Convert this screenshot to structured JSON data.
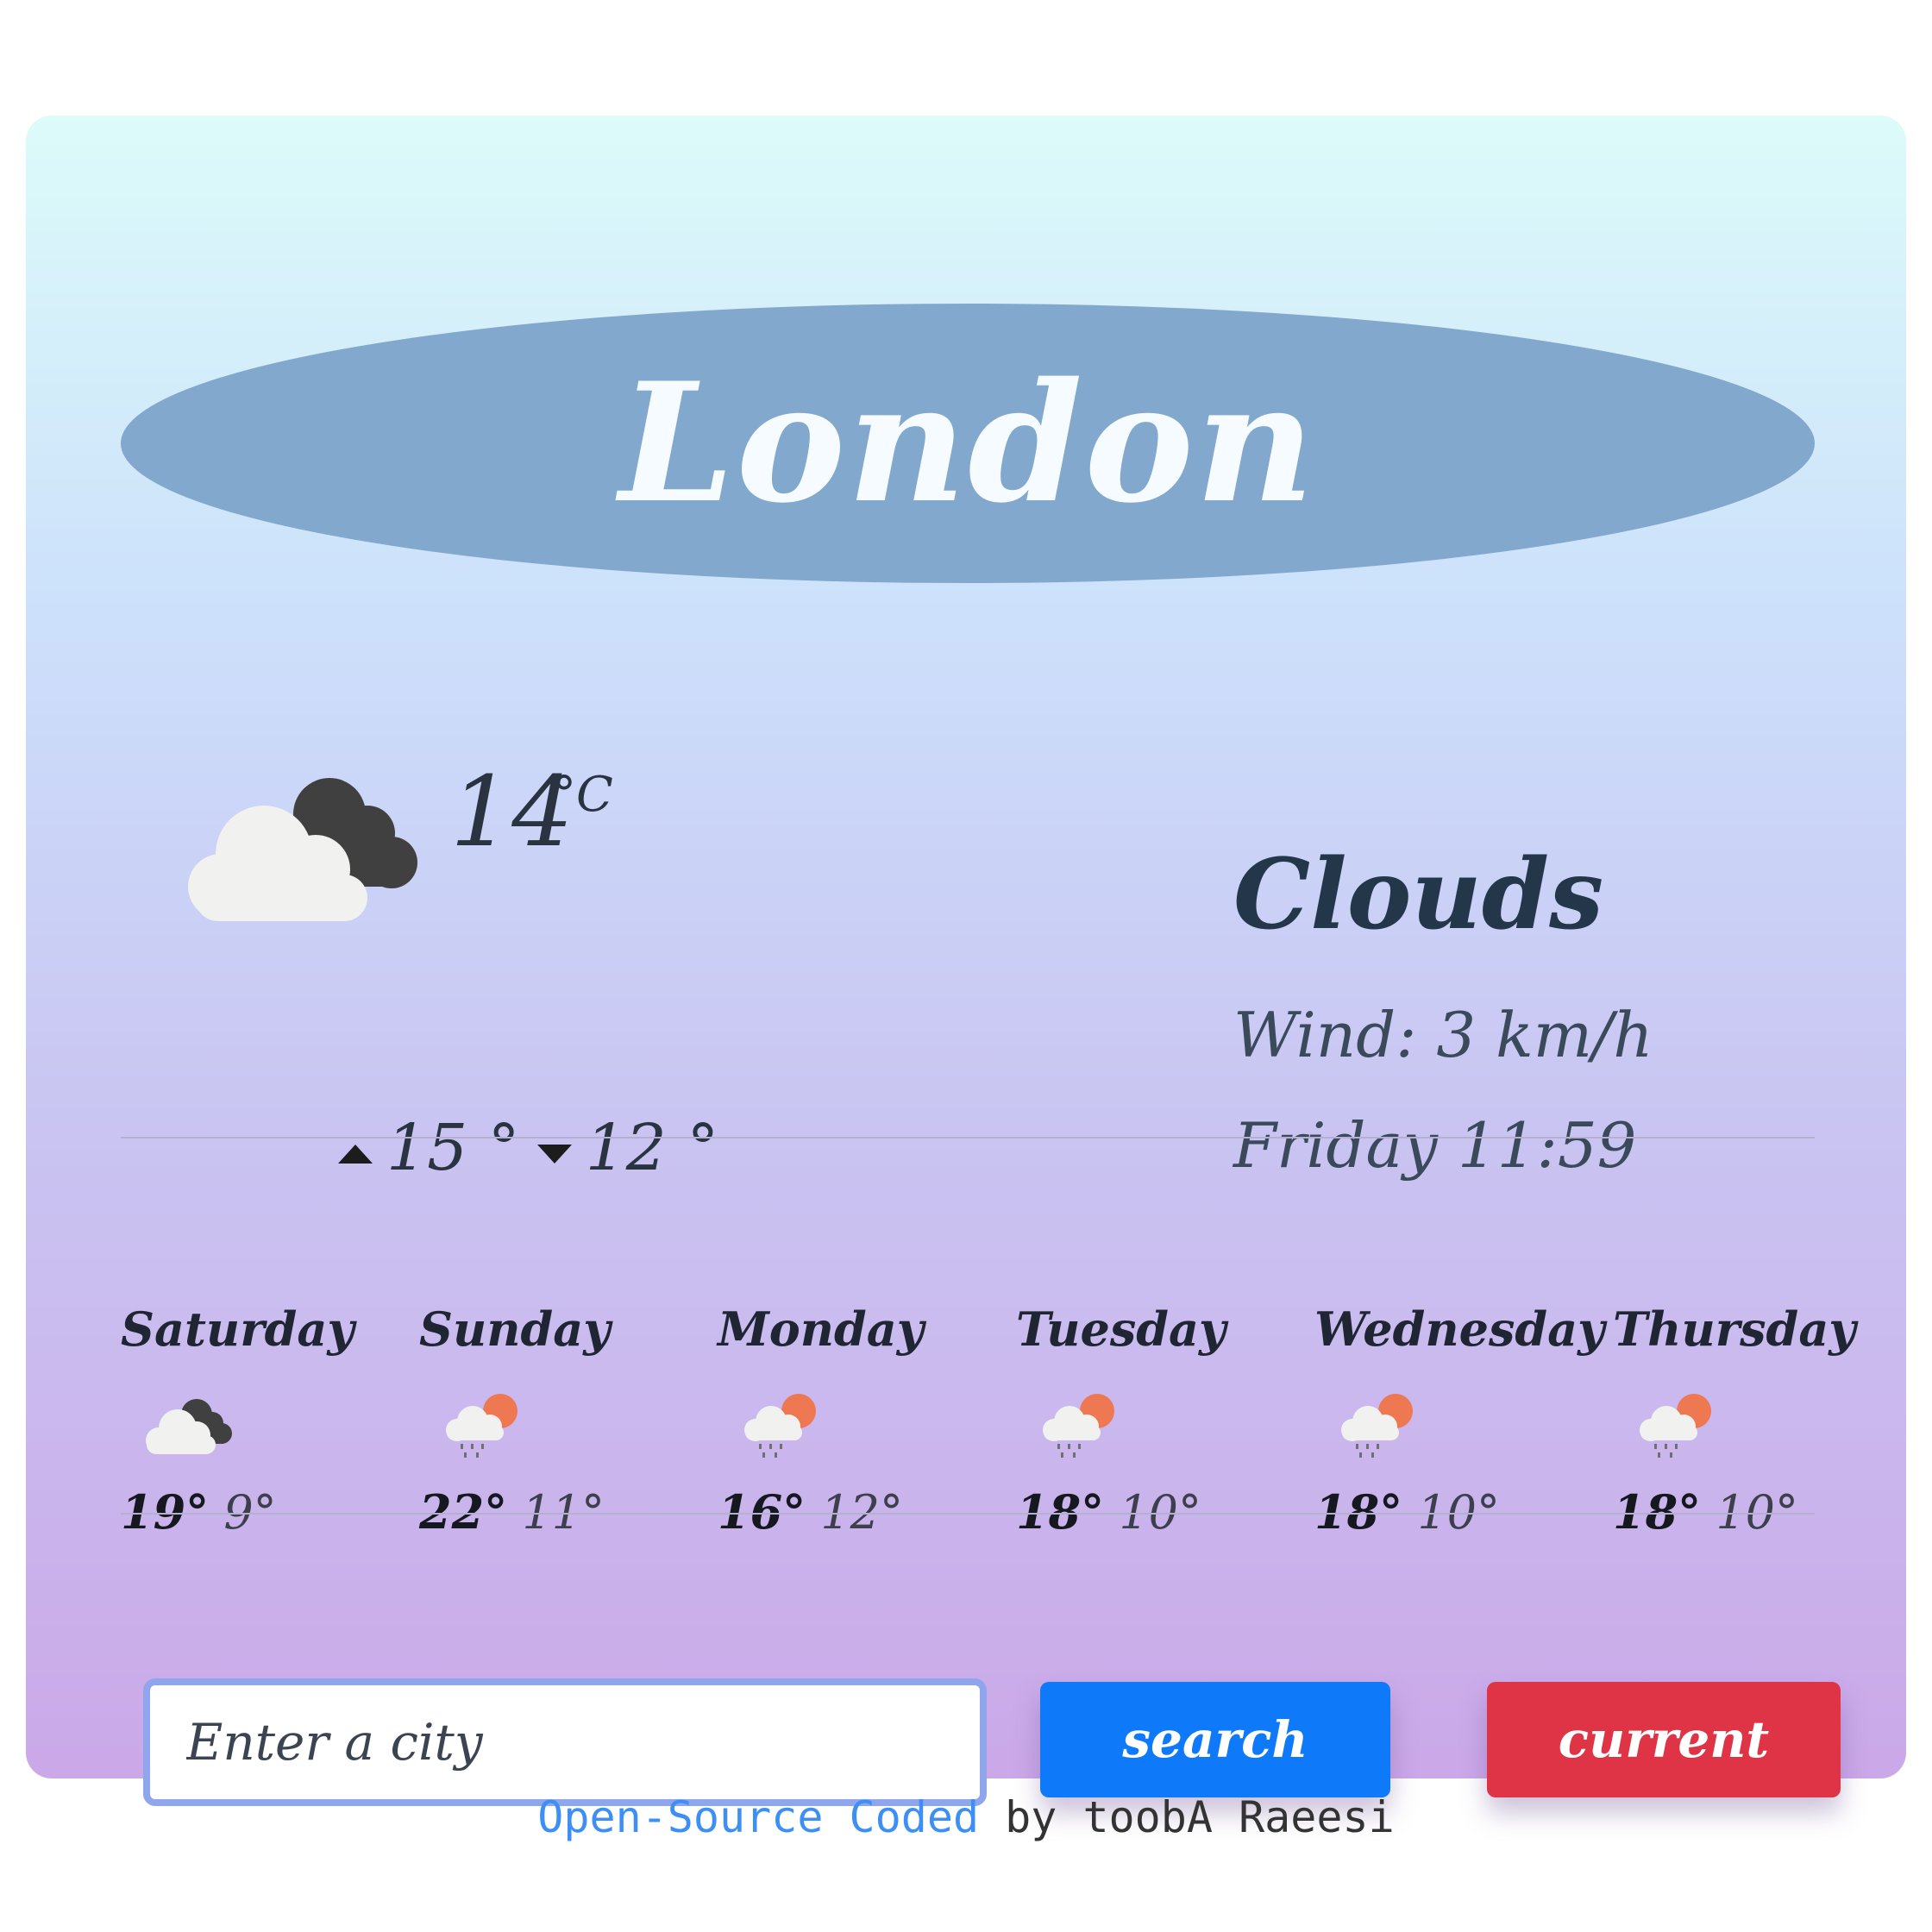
{
  "city": "London",
  "current": {
    "icon": "cloud-icon",
    "temperature": "14",
    "unit": "°C",
    "high": "15 °",
    "low": "12 °",
    "description": "Clouds",
    "wind": "Wind: 3 km/h",
    "datetime": "Friday 11:59"
  },
  "forecast": [
    {
      "day": "Saturday",
      "icon": "cloud-icon",
      "max": "19°",
      "min": "9°"
    },
    {
      "day": "Sunday",
      "icon": "rain-sun-icon",
      "max": "22°",
      "min": "11°"
    },
    {
      "day": "Monday",
      "icon": "rain-sun-icon",
      "max": "16°",
      "min": "12°"
    },
    {
      "day": "Tuesday",
      "icon": "rain-sun-icon",
      "max": "18°",
      "min": "10°"
    },
    {
      "day": "Wednesday",
      "icon": "rain-sun-icon",
      "max": "18°",
      "min": "10°"
    },
    {
      "day": "Thursday",
      "icon": "rain-sun-icon",
      "max": "18°",
      "min": "10°"
    }
  ],
  "search": {
    "placeholder": "Enter a city",
    "value": "",
    "search_label": "search",
    "current_label": "current"
  },
  "footer": {
    "link_text": "Open-Source Coded",
    "author_text": " by toobA Raeesi"
  },
  "colors": {
    "oval": "#82a8cd",
    "search_button": "#0f7af9",
    "current_button": "#de3446",
    "link": "#3d8ff5"
  }
}
